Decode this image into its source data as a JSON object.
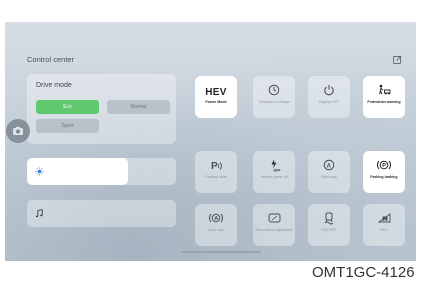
{
  "screen": {
    "title": "Control center",
    "drive_mode": {
      "label": "Drive mode",
      "options": [
        "Eco",
        "Normal",
        "Sport"
      ],
      "selected": "Eco",
      "selected_color": "#62c86f"
    },
    "brightness_slider": {
      "icon": "brightness-icon",
      "level": 0.68
    },
    "volume_slider": {
      "icon": "music-note-icon",
      "level": 0.0
    },
    "tiles": [
      {
        "label": "Power Mode",
        "value": "HEV",
        "icon": "hev-text",
        "active": true
      },
      {
        "label": "Schedule to charge",
        "icon": "clock-icon",
        "active": false
      },
      {
        "label": "Display OFF",
        "icon": "power-icon",
        "active": false
      },
      {
        "label": "Pedestrian warning",
        "icon": "pedestrian-icon",
        "active": true
      },
      {
        "label": "Parking radar",
        "icon": "parking-radar-icon",
        "active": false
      },
      {
        "label": "Vehicle power off",
        "icon": "vehicle-power-icon",
        "active": false
      },
      {
        "label": "Start-stop",
        "icon": "start-stop-icon",
        "active": false
      },
      {
        "label": "Parking braking",
        "icon": "parking-brake-icon",
        "active": true
      },
      {
        "label": "Auto hold",
        "icon": "auto-hold-icon",
        "active": false
      },
      {
        "label": "Rear-mirror adjustment",
        "icon": "mirror-icon",
        "active": false
      },
      {
        "label": "ESC OFF",
        "icon": "esc-icon",
        "active": false
      },
      {
        "label": "HDC",
        "icon": "hdc-icon",
        "active": false
      }
    ]
  },
  "figure_code": "OMT1GC-4126"
}
